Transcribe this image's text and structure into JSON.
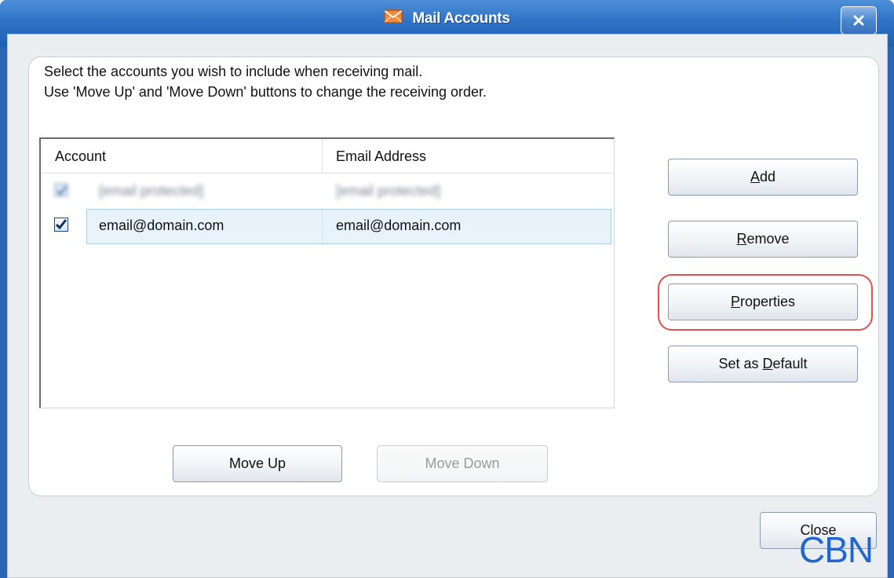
{
  "window": {
    "title": "Mail Accounts"
  },
  "instructions": {
    "line1": "Select the accounts you wish to include when receiving mail.",
    "line2": "Use 'Move Up' and 'Move Down' buttons to change the receiving order."
  },
  "accounts_table": {
    "columns": [
      "Account",
      "Email Address"
    ],
    "rows": [
      {
        "checked": true,
        "account": "[email protected]",
        "email": "[email protected]",
        "obscured": true
      },
      {
        "checked": true,
        "account": "email@domain.com",
        "email": "email@domain.com",
        "selected": true
      }
    ]
  },
  "side_buttons": {
    "add": {
      "label": "Add",
      "mnemonic": "A",
      "rest": "dd"
    },
    "remove": {
      "label": "Remove",
      "mnemonic": "R",
      "rest": "emove"
    },
    "properties": {
      "label": "Properties",
      "mnemonic": "P",
      "rest": "roperties"
    },
    "set_default": {
      "label": "Set as Default",
      "prefix": "Set as ",
      "mnemonic": "D",
      "rest": "efault"
    }
  },
  "order_buttons": {
    "move_up": "Move Up",
    "move_down": "Move Down"
  },
  "footer": {
    "close": "Close"
  },
  "watermark": "CBN",
  "colors": {
    "titlebar": "#2f73c7",
    "highlight_ring": "#e0504f",
    "selected_row": "#e7f2fb",
    "watermark": "#2266cc"
  },
  "icons": {
    "title_icon": "envelope-icon",
    "close": "close-icon",
    "check": "checkmark-icon"
  }
}
